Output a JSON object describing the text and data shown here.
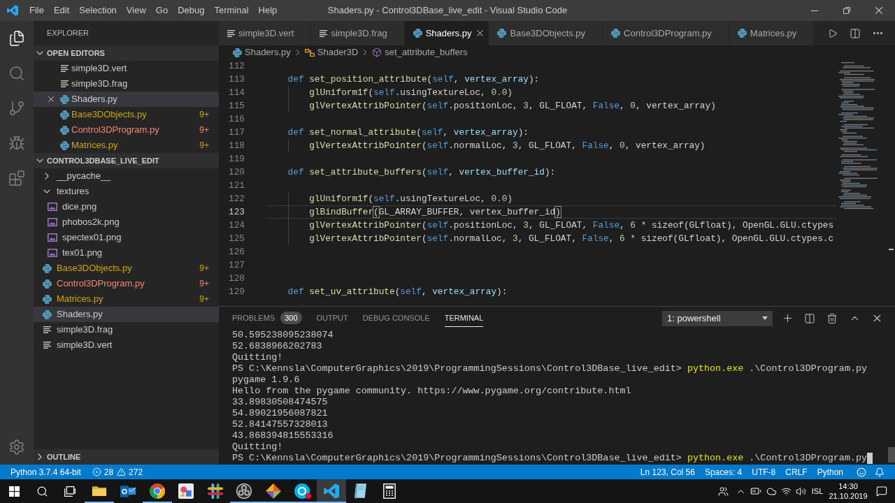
{
  "window": {
    "title": "Shaders.py - Control3DBase_live_edit - Visual Studio Code"
  },
  "menu": [
    "File",
    "Edit",
    "Selection",
    "View",
    "Go",
    "Debug",
    "Terminal",
    "Help"
  ],
  "activity_bar": [
    {
      "kind": "explorer",
      "selected": true
    },
    {
      "kind": "search",
      "selected": false
    },
    {
      "kind": "source_control",
      "selected": false
    },
    {
      "kind": "debug",
      "selected": false
    },
    {
      "kind": "extensions",
      "selected": false
    },
    {
      "kind": "settings",
      "selected": false
    }
  ],
  "sidebar": {
    "title": "EXPLORER",
    "open_editors": {
      "title": "OPEN EDITORS",
      "expanded": true,
      "items": [
        {
          "name": "simple3D.vert",
          "kind": "text",
          "selected": false,
          "color": "#cccccc"
        },
        {
          "name": "simple3D.frag",
          "kind": "text",
          "selected": false,
          "color": "#cccccc"
        },
        {
          "name": "Shaders.py",
          "kind": "python",
          "selected": true,
          "color": "#cccccc"
        },
        {
          "name": "Base3DObjects.py",
          "kind": "python",
          "selected": false,
          "color": "#cca700",
          "badge": "9+"
        },
        {
          "name": "Control3DProgram.py",
          "kind": "python",
          "selected": false,
          "color": "#f48771",
          "badge": "9+"
        },
        {
          "name": "Matrices.py",
          "kind": "python",
          "selected": false,
          "color": "#cca700",
          "badge": "9+"
        }
      ]
    },
    "folder": {
      "title": "CONTROL3DBASE_LIVE_EDIT",
      "expanded": true,
      "items": [
        {
          "name": "__pycache__",
          "kind": "folder",
          "expanded": false,
          "selected": false,
          "color": "#cccccc"
        },
        {
          "name": "textures",
          "kind": "folder",
          "expanded": true,
          "selected": false,
          "color": "#cccccc",
          "children": [
            {
              "name": "dice.png",
              "kind": "image",
              "selected": false,
              "color": "#cccccc"
            },
            {
              "name": "phobos2k.png",
              "kind": "image",
              "selected": false,
              "color": "#cccccc"
            },
            {
              "name": "spectex01.png",
              "kind": "image",
              "selected": false,
              "color": "#cccccc"
            },
            {
              "name": "tex01.png",
              "kind": "image",
              "selected": false,
              "color": "#cccccc"
            }
          ]
        },
        {
          "name": "Base3DObjects.py",
          "kind": "python",
          "selected": false,
          "color": "#cca700",
          "badge": "9+"
        },
        {
          "name": "Control3DProgram.py",
          "kind": "python",
          "selected": false,
          "color": "#f48771",
          "badge": "9+"
        },
        {
          "name": "Matrices.py",
          "kind": "python",
          "selected": false,
          "color": "#cca700",
          "badge": "9+"
        },
        {
          "name": "Shaders.py",
          "kind": "python",
          "selected": true,
          "color": "#cccccc"
        },
        {
          "name": "simple3D.frag",
          "kind": "text",
          "selected": false,
          "color": "#cccccc"
        },
        {
          "name": "simple3D.vert",
          "kind": "text",
          "selected": false,
          "color": "#cccccc"
        }
      ]
    },
    "outline": {
      "title": "OUTLINE",
      "expanded": false
    }
  },
  "editor": {
    "tabs": [
      {
        "label": "simple3D.vert",
        "kind": "text",
        "selected": false
      },
      {
        "label": "simple3D.frag",
        "kind": "text",
        "selected": false
      },
      {
        "label": "Shaders.py",
        "kind": "python",
        "selected": true
      },
      {
        "label": "Base3DObjects.py",
        "kind": "python",
        "selected": false
      },
      {
        "label": "Control3DProgram.py",
        "kind": "python",
        "selected": false
      },
      {
        "label": "Matrices.py",
        "kind": "python",
        "selected": false
      }
    ],
    "breadcrumbs": [
      {
        "label": "Shaders.py",
        "kind": "python"
      },
      {
        "label": "Shader3D",
        "kind": "class"
      },
      {
        "label": "set_attribute_buffers",
        "kind": "method"
      }
    ],
    "lines": [
      {
        "number": "112",
        "current": false
      },
      {
        "number": "113",
        "current": false,
        "tokens": [
          {
            "text": "    def ",
            "kind": "keyword"
          },
          {
            "text": "set_position_attribute",
            "kind": "function"
          },
          {
            "text": "(",
            "kind": "plain"
          },
          {
            "text": "self",
            "kind": "keyword"
          },
          {
            "text": ", ",
            "kind": "plain"
          },
          {
            "text": "vertex_array",
            "kind": "param"
          },
          {
            "text": "):",
            "kind": "plain"
          }
        ]
      },
      {
        "number": "114",
        "current": false,
        "tokens": [
          {
            "text": "        glUniform1f",
            "kind": "function"
          },
          {
            "text": "(",
            "kind": "plain"
          },
          {
            "text": "self",
            "kind": "keyword"
          },
          {
            "text": ".usingTextureLoc, ",
            "kind": "plain"
          },
          {
            "text": "0.0",
            "kind": "number"
          },
          {
            "text": ")",
            "kind": "plain"
          }
        ]
      },
      {
        "number": "115",
        "current": false,
        "tokens": [
          {
            "text": "        glVertexAttribPointer",
            "kind": "function"
          },
          {
            "text": "(",
            "kind": "plain"
          },
          {
            "text": "self",
            "kind": "keyword"
          },
          {
            "text": ".positionLoc, ",
            "kind": "plain"
          },
          {
            "text": "3",
            "kind": "number"
          },
          {
            "text": ", GL_FLOAT, ",
            "kind": "plain"
          },
          {
            "text": "False",
            "kind": "keyword"
          },
          {
            "text": ", ",
            "kind": "plain"
          },
          {
            "text": "0",
            "kind": "number"
          },
          {
            "text": ", vertex_array)",
            "kind": "plain"
          }
        ]
      },
      {
        "number": "116",
        "current": false
      },
      {
        "number": "117",
        "current": false,
        "tokens": [
          {
            "text": "    def ",
            "kind": "keyword"
          },
          {
            "text": "set_normal_attribute",
            "kind": "function"
          },
          {
            "text": "(",
            "kind": "plain"
          },
          {
            "text": "self",
            "kind": "keyword"
          },
          {
            "text": ", ",
            "kind": "plain"
          },
          {
            "text": "vertex_array",
            "kind": "param"
          },
          {
            "text": "):",
            "kind": "plain"
          }
        ]
      },
      {
        "number": "118",
        "current": false,
        "tokens": [
          {
            "text": "        glVertexAttribPointer",
            "kind": "function"
          },
          {
            "text": "(",
            "kind": "plain"
          },
          {
            "text": "self",
            "kind": "keyword"
          },
          {
            "text": ".normalLoc, ",
            "kind": "plain"
          },
          {
            "text": "3",
            "kind": "number"
          },
          {
            "text": ", GL_FLOAT, ",
            "kind": "plain"
          },
          {
            "text": "False",
            "kind": "keyword"
          },
          {
            "text": ", ",
            "kind": "plain"
          },
          {
            "text": "0",
            "kind": "number"
          },
          {
            "text": ", vertex_array)",
            "kind": "plain"
          }
        ]
      },
      {
        "number": "119",
        "current": false
      },
      {
        "number": "120",
        "current": false,
        "tokens": [
          {
            "text": "    def ",
            "kind": "keyword"
          },
          {
            "text": "set_attribute_buffers",
            "kind": "function"
          },
          {
            "text": "(",
            "kind": "plain"
          },
          {
            "text": "self",
            "kind": "keyword"
          },
          {
            "text": ", ",
            "kind": "plain"
          },
          {
            "text": "vertex_buffer_id",
            "kind": "param"
          },
          {
            "text": "):",
            "kind": "plain"
          }
        ]
      },
      {
        "number": "121",
        "current": false
      },
      {
        "number": "122",
        "current": false,
        "tokens": [
          {
            "text": "        glUniform1f",
            "kind": "function"
          },
          {
            "text": "(",
            "kind": "plain"
          },
          {
            "text": "self",
            "kind": "keyword"
          },
          {
            "text": ".usingTextureLoc, ",
            "kind": "plain"
          },
          {
            "text": "0.0",
            "kind": "number"
          },
          {
            "text": ")",
            "kind": "plain"
          }
        ]
      },
      {
        "number": "123",
        "current": true,
        "tokens": [
          {
            "text": "        glBindBuffer",
            "kind": "function"
          },
          {
            "text": "(",
            "kind": "bracket"
          },
          {
            "text": "GL_ARRAY_BUFFER, vertex_buffer_id",
            "kind": "plain"
          },
          {
            "text": ")",
            "kind": "bracket"
          }
        ]
      },
      {
        "number": "124",
        "current": false,
        "tokens": [
          {
            "text": "        glVertexAttribPointer",
            "kind": "function"
          },
          {
            "text": "(",
            "kind": "plain"
          },
          {
            "text": "self",
            "kind": "keyword"
          },
          {
            "text": ".positionLoc, ",
            "kind": "plain"
          },
          {
            "text": "3",
            "kind": "number"
          },
          {
            "text": ", GL_FLOAT, ",
            "kind": "plain"
          },
          {
            "text": "False",
            "kind": "keyword"
          },
          {
            "text": ", ",
            "kind": "plain"
          },
          {
            "text": "6",
            "kind": "number"
          },
          {
            "text": " * sizeof(GLfloat), OpenGL.GLU.ctypes",
            "kind": "plain"
          }
        ]
      },
      {
        "number": "125",
        "current": false,
        "tokens": [
          {
            "text": "        glVertexAttribPointer",
            "kind": "function"
          },
          {
            "text": "(",
            "kind": "plain"
          },
          {
            "text": "self",
            "kind": "keyword"
          },
          {
            "text": ".normalLoc, ",
            "kind": "plain"
          },
          {
            "text": "3",
            "kind": "number"
          },
          {
            "text": ", GL_FLOAT, ",
            "kind": "plain"
          },
          {
            "text": "False",
            "kind": "keyword"
          },
          {
            "text": ", ",
            "kind": "plain"
          },
          {
            "text": "6",
            "kind": "number"
          },
          {
            "text": " * sizeof(GLfloat), OpenGL.GLU.ctypes.c",
            "kind": "plain"
          }
        ]
      },
      {
        "number": "126",
        "current": false
      },
      {
        "number": "127",
        "current": false
      },
      {
        "number": "128",
        "current": false
      },
      {
        "number": "129",
        "current": false,
        "tokens": [
          {
            "text": "    def ",
            "kind": "keyword"
          },
          {
            "text": "set_uv_attribute",
            "kind": "function"
          },
          {
            "text": "(",
            "kind": "plain"
          },
          {
            "text": "self",
            "kind": "keyword"
          },
          {
            "text": ", ",
            "kind": "plain"
          },
          {
            "text": "vertex_array",
            "kind": "param"
          },
          {
            "text": "):",
            "kind": "plain"
          }
        ]
      }
    ]
  },
  "panel": {
    "tabs": [
      {
        "label": "PROBLEMS",
        "badge": "300",
        "selected": false
      },
      {
        "label": "OUTPUT",
        "selected": false
      },
      {
        "label": "DEBUG CONSOLE",
        "selected": false
      },
      {
        "label": "TERMINAL",
        "selected": true
      }
    ],
    "terminal_select": "1: powershell",
    "terminal": {
      "cursor": true,
      "lines": [
        {
          "kind": "output",
          "text": "50.595238095238074"
        },
        {
          "kind": "output",
          "text": "52.6838966202783"
        },
        {
          "kind": "output",
          "text": "Quitting!"
        },
        {
          "kind": "prompt",
          "prompt": "PS C:\\Kennsla\\ComputerGraphics\\2019\\ProgrammingSessions\\Control3DBase_live_edit>",
          "command": "python.exe",
          "args": ".\\Control3DProgram.py"
        },
        {
          "kind": "output",
          "text": "pygame 1.9.6"
        },
        {
          "kind": "output",
          "text": "Hello from the pygame community. https://www.pygame.org/contribute.html"
        },
        {
          "kind": "output",
          "text": "33.89830508474575"
        },
        {
          "kind": "output",
          "text": "54.89021956087821"
        },
        {
          "kind": "output",
          "text": "52.84147557328013"
        },
        {
          "kind": "output",
          "text": "43.868394815553316"
        },
        {
          "kind": "output",
          "text": "Quitting!"
        },
        {
          "kind": "prompt",
          "prompt": "PS C:\\Kennsla\\ComputerGraphics\\2019\\ProgrammingSessions\\Control3DBase_live_edit>",
          "command": "python.exe",
          "args": ".\\Control3DProgram.py"
        }
      ]
    }
  },
  "status_bar": {
    "interpreter": "Python 3.7.4 64-bit",
    "errors": "28",
    "warnings": "272",
    "items": [
      "Ln 123, Col 56",
      "Spaces: 4",
      "UTF-8",
      "CRLF",
      "Python"
    ]
  },
  "taskbar": {
    "apps": [
      {
        "kind": "explorer",
        "active": false,
        "running": true,
        "alert": false
      },
      {
        "kind": "mail",
        "active": false,
        "running": false,
        "alert": false
      },
      {
        "kind": "browser",
        "active": false,
        "running": true,
        "alert": false
      },
      {
        "kind": "paint",
        "active": false,
        "running": false,
        "alert": false
      },
      {
        "kind": "chat",
        "active": false,
        "running": false,
        "alert": false
      },
      {
        "kind": "recorder",
        "active": false,
        "running": true,
        "alert": false
      },
      {
        "kind": "git",
        "active": false,
        "running": true,
        "alert": false
      },
      {
        "kind": "messenger",
        "active": false,
        "running": true,
        "alert": true
      },
      {
        "kind": "editor",
        "active": true,
        "running": true,
        "alert": false
      },
      {
        "kind": "notebook",
        "active": false,
        "running": false,
        "alert": false
      },
      {
        "kind": "calculator",
        "active": false,
        "running": false,
        "alert": false
      }
    ],
    "tray": {
      "language": "ISL",
      "time": "14:30",
      "date": "21.10.2019"
    }
  }
}
